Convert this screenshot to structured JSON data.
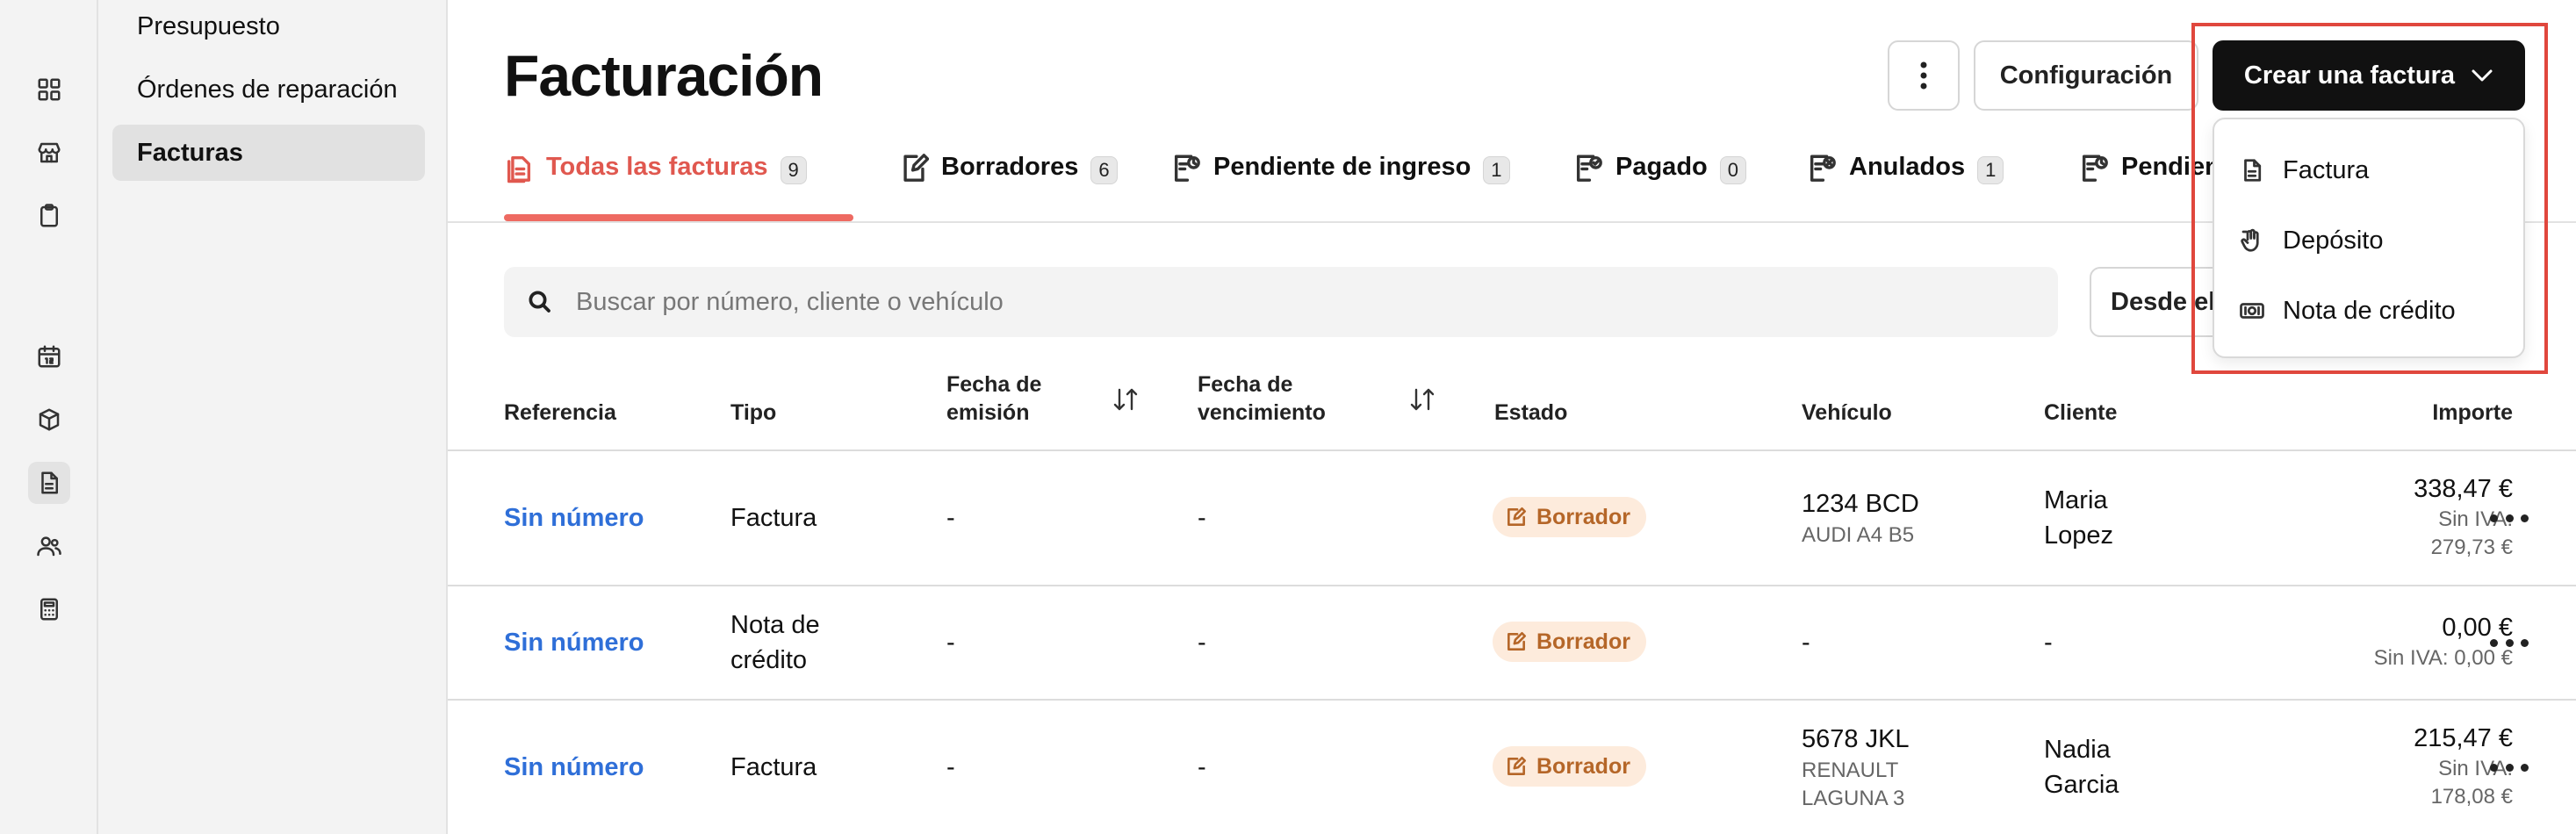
{
  "sidebar": {
    "items": [
      {
        "label": "Presupuesto"
      },
      {
        "label": "Órdenes de reparación"
      },
      {
        "label": "Facturas"
      }
    ]
  },
  "page": {
    "title": "Facturación"
  },
  "toolbar": {
    "more_icon": "more-vertical-icon",
    "config_label": "Configuración",
    "create_label": "Crear una factura"
  },
  "tabs": [
    {
      "label": "Todas las facturas",
      "count": "9"
    },
    {
      "label": "Borradores",
      "count": "6"
    },
    {
      "label": "Pendiente de ingreso",
      "count": "1"
    },
    {
      "label": "Pagado",
      "count": "0"
    },
    {
      "label": "Anulados",
      "count": "1"
    },
    {
      "label": "Pendiente"
    }
  ],
  "search": {
    "placeholder": "Buscar por número, cliente o vehículo"
  },
  "filter": {
    "date_label": "Desde el"
  },
  "table": {
    "headers": {
      "referencia": "Referencia",
      "tipo": "Tipo",
      "fecha_emision_1": "Fecha de",
      "fecha_emision_2": "emisión",
      "fecha_venc_1": "Fecha de",
      "fecha_venc_2": "vencimiento",
      "estado": "Estado",
      "vehiculo": "Vehículo",
      "cliente": "Cliente",
      "importe": "Importe"
    },
    "rows": [
      {
        "referencia": "Sin número",
        "tipo_1": "Factura",
        "tipo_2": "",
        "emision": "-",
        "vencimiento": "-",
        "estado": "Borrador",
        "vehiculo_1": "1234 BCD",
        "vehiculo_2": "AUDI A4 B5",
        "vehiculo_3": "",
        "cliente_1": "Maria",
        "cliente_2": "Lopez",
        "importe": "338,47 €",
        "sin_iva_1": "Sin IVA:",
        "sin_iva_2": "279,73 €"
      },
      {
        "referencia": "Sin número",
        "tipo_1": "Nota de",
        "tipo_2": "crédito",
        "emision": "-",
        "vencimiento": "-",
        "estado": "Borrador",
        "vehiculo_1": "-",
        "vehiculo_2": "",
        "vehiculo_3": "",
        "cliente_1": "-",
        "cliente_2": "",
        "importe": "0,00 €",
        "sin_iva_1": "Sin IVA: 0,00 €",
        "sin_iva_2": ""
      },
      {
        "referencia": "Sin número",
        "tipo_1": "Factura",
        "tipo_2": "",
        "emision": "-",
        "vencimiento": "-",
        "estado": "Borrador",
        "vehiculo_1": "5678 JKL",
        "vehiculo_2": "RENAULT",
        "vehiculo_3": "LAGUNA 3",
        "cliente_1": "Nadia",
        "cliente_2": "Garcia",
        "importe": "215,47 €",
        "sin_iva_1": "Sin IVA:",
        "sin_iva_2": "178,08 €"
      }
    ]
  },
  "dropdown": {
    "items": [
      {
        "label": "Factura",
        "icon": "document-icon"
      },
      {
        "label": "Depósito",
        "icon": "deposit-hand-icon"
      },
      {
        "label": "Nota de crédito",
        "icon": "banknote-icon"
      }
    ]
  },
  "colors": {
    "accent": "#e0584f",
    "link": "#2f6fd8",
    "badge_bg": "#fdebdc",
    "badge_text": "#b56628",
    "highlight": "#e0473d"
  }
}
